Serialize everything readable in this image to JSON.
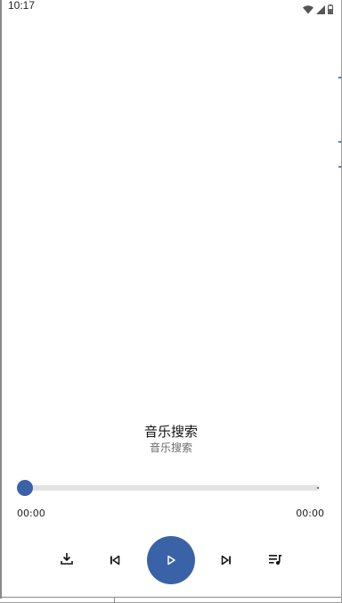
{
  "status_bar": {
    "time": "10:17",
    "icons": [
      "wifi-icon",
      "cellular-signal-icon",
      "battery-icon"
    ]
  },
  "song": {
    "title": "音乐搜索",
    "artist": "音乐搜索"
  },
  "progress": {
    "current_time": "00:00",
    "total_time": "00:00",
    "fraction": 0
  },
  "controls": {
    "buttons": [
      "download-icon",
      "skip-previous-icon",
      "play-icon",
      "skip-next-icon",
      "playlist-icon"
    ]
  },
  "colors": {
    "accent": "#3a62a7",
    "track": "#e2e2e2",
    "text_primary": "#111111",
    "text_secondary": "#6b6b6b"
  }
}
